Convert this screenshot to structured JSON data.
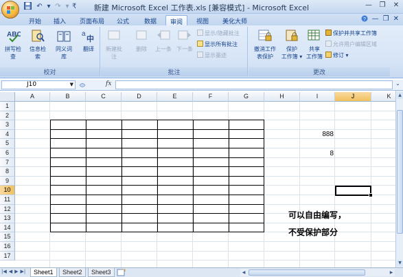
{
  "window": {
    "title": "新建 Microsoft Excel 工作表.xls  [兼容模式] - Microsoft Excel",
    "controls": [
      "—",
      "❐",
      "✕"
    ]
  },
  "tabs": [
    "开始",
    "插入",
    "页面布局",
    "公式",
    "数据",
    "审阅",
    "视图",
    "美化大师"
  ],
  "active_tab": "审阅",
  "ribbon": {
    "proofing": {
      "label": "校对",
      "buttons": [
        "拼写检查",
        "信息检索",
        "同义词库",
        "翻译"
      ]
    },
    "comments": {
      "label": "批注",
      "buttons": [
        "新建批注",
        "删除",
        "上一条",
        "下一条"
      ],
      "options": [
        "显示/隐藏批注",
        "显示所有批注",
        "显示墨迹"
      ]
    },
    "changes": {
      "label": "更改",
      "buttons": [
        {
          "line1": "撤消工作",
          "line2": "表保护"
        },
        {
          "line1": "保护",
          "line2": "工作簿 ▾"
        },
        {
          "line1": "共享",
          "line2": "工作簿"
        }
      ],
      "options": [
        "保护并共享工作簿",
        "允许用户编辑区域",
        "修订 ▾"
      ]
    }
  },
  "formula_bar": {
    "name_box": "J10",
    "fx": "fx",
    "value": ""
  },
  "columns": [
    "A",
    "B",
    "C",
    "D",
    "E",
    "F",
    "G",
    "H",
    "I",
    "J",
    "K"
  ],
  "selected_column": "J",
  "rows": [
    "1",
    "2",
    "3",
    "4",
    "5",
    "6",
    "7",
    "8",
    "9",
    "10",
    "11",
    "12",
    "13",
    "14",
    "15",
    "16",
    "17"
  ],
  "selected_row": "10",
  "cells": {
    "I4": "888",
    "I6": "8"
  },
  "note": {
    "line1": "可以自由编写，",
    "line2": "不受保护部分"
  },
  "sheets": [
    "Sheet1",
    "Sheet2",
    "Sheet3"
  ],
  "active_sheet": "Sheet1",
  "colors": {
    "accent": "#15428b",
    "ribbon_bg": "#d6e4f6",
    "header_selected": "#f1c15f"
  }
}
